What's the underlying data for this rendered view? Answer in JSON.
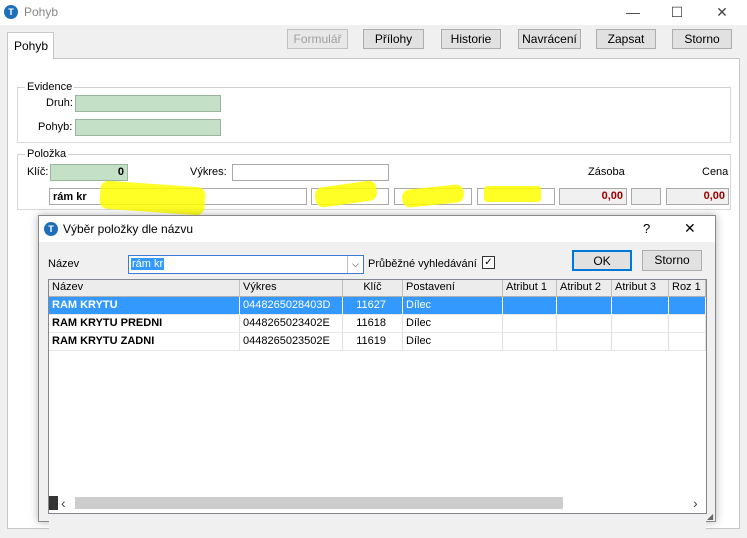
{
  "window": {
    "title": "Pohyb",
    "app_icon": "T",
    "minimize": "—",
    "maximize": "☐",
    "close": "✕"
  },
  "tab": {
    "label": "Pohyb"
  },
  "toolbar": {
    "formular": "Formulář",
    "prilohy": "Přílohy",
    "historie": "Historie",
    "navraceni": "Navrácení",
    "zapsat": "Zapsat",
    "storno": "Storno"
  },
  "evidence": {
    "group_label": "Evidence",
    "druh_label": "Druh:",
    "pohyb_label": "Pohyb:"
  },
  "polozka": {
    "group_label": "Položka",
    "klic_label": "Klíč:",
    "klic_value": "0",
    "vykres_label": "Výkres:",
    "zasoba_label": "Zásoba",
    "cena_label": "Cena",
    "name_value": "rám kr",
    "zasoba_value": "0,00",
    "cena_value": "0,00"
  },
  "dialog": {
    "title": "Výběr položky dle názvu",
    "help": "?",
    "close": "✕",
    "nazev_label": "Název",
    "search_value": "rám kr",
    "live_search_label": "Průběžné vyhledávání",
    "live_search_checked": "✓",
    "ok": "OK",
    "storno": "Storno",
    "columns": [
      "Název",
      "Výkres",
      "Klíč",
      "Postavení",
      "Atribut 1",
      "Atribut 2",
      "Atribut 3",
      "Roz 1"
    ],
    "rows": [
      {
        "nazev": "RAM KRYTU",
        "vykres": "0448265028403D",
        "klic": "11627",
        "postaveni": "Dílec"
      },
      {
        "nazev": "RAM KRYTU PREDNI",
        "vykres": "0448265023402E",
        "klic": "11618",
        "postaveni": "Dílec"
      },
      {
        "nazev": "RAM KRYTU ZADNI",
        "vykres": "0448265023502E",
        "klic": "11619",
        "postaveni": "Dílec"
      }
    ],
    "scroll_left": "‹",
    "scroll_right": "›"
  },
  "colors": {
    "selection": "#3399ff",
    "green_field": "#c4e0c7",
    "highlight": "#ffff00",
    "value_red": "#a00000"
  }
}
